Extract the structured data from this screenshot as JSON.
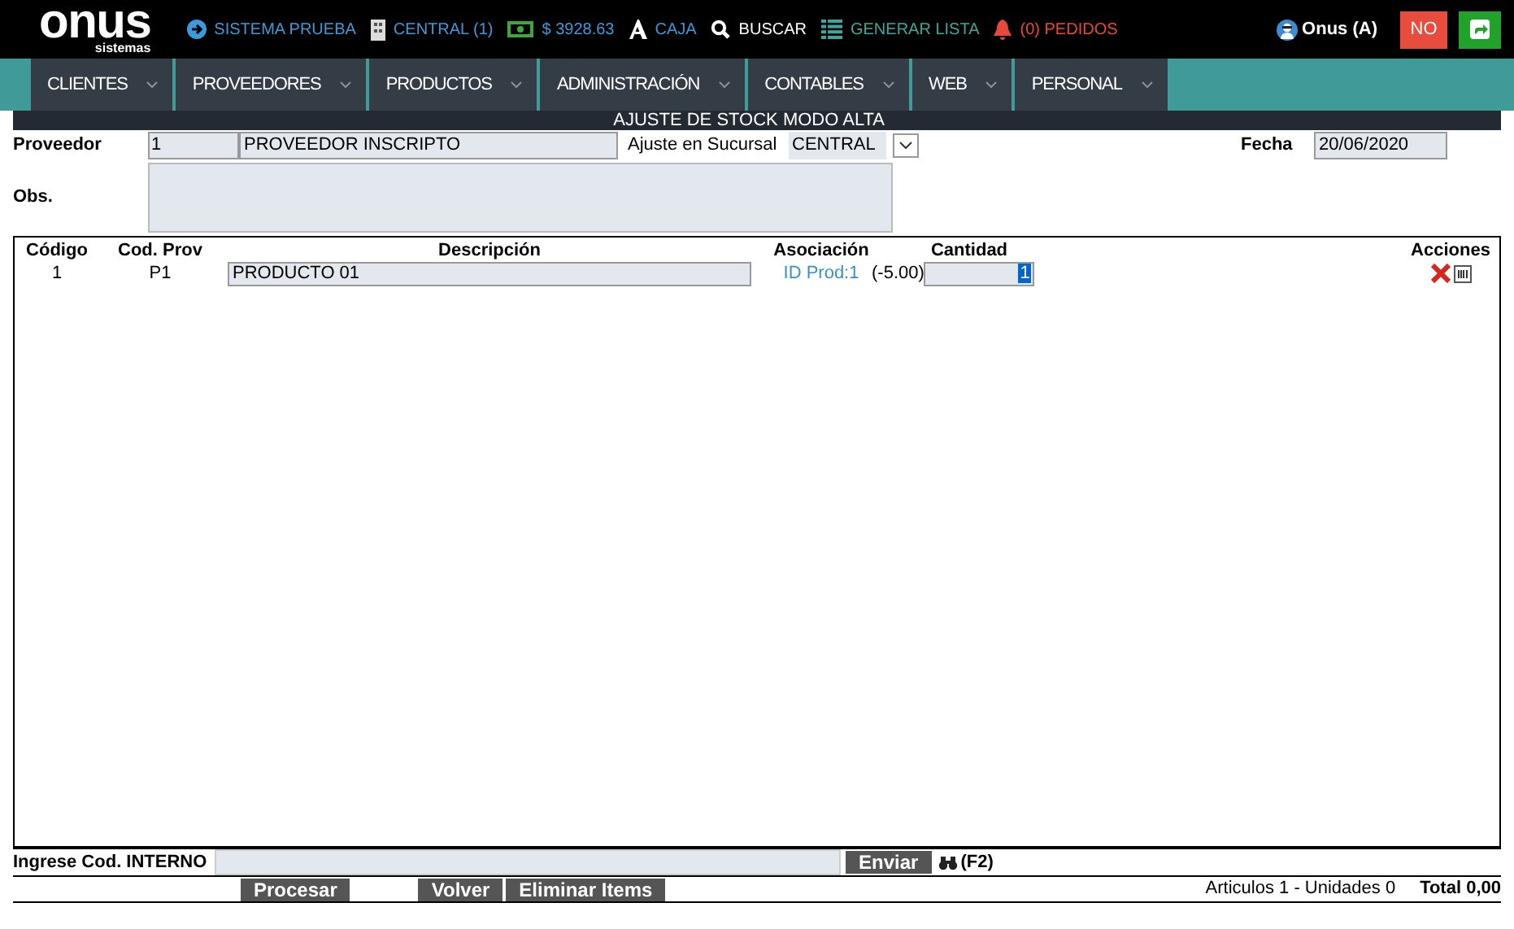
{
  "header": {
    "logo": "onus",
    "logo_sub": "sistemas",
    "items": [
      {
        "label": "SISTEMA PRUEBA",
        "color": "#3b9ad9"
      },
      {
        "label": "CENTRAL (1)",
        "color": "#3b9ad9"
      },
      {
        "label": "$ 3928.63",
        "color": "#3b9ad9"
      },
      {
        "label": "CAJA",
        "color": "#3b9ad9"
      },
      {
        "label": "BUSCAR",
        "color": "#ffffff"
      },
      {
        "label": "GENERAR LISTA",
        "color": "#3aa89c"
      },
      {
        "label": "(0) PEDIDOS",
        "color": "#e8473b"
      }
    ],
    "user": "Onus (A)",
    "no_button": "NO"
  },
  "nav": [
    "CLIENTES",
    "PROVEEDORES",
    "PRODUCTOS",
    "ADMINISTRACIÓN",
    "CONTABLES",
    "WEB",
    "PERSONAL"
  ],
  "title": "AJUSTE DE STOCK MODO ALTA",
  "form": {
    "proveedor_label": "Proveedor",
    "proveedor_code": "1",
    "proveedor_name": "PROVEEDOR INSCRIPTO",
    "sucursal_label": "Ajuste en Sucursal",
    "sucursal": "CENTRAL",
    "fecha_label": "Fecha",
    "fecha": "20/06/2020",
    "obs_label": "Obs."
  },
  "table": {
    "columns": [
      "Código",
      "Cod. Prov",
      "Descripción",
      "Asociación",
      "Cantidad",
      "Acciones"
    ],
    "rows": [
      {
        "codigo": "1",
        "cod_prov": "P1",
        "descripcion": "PRODUCTO 01",
        "asociacion": "ID Prod:1",
        "stock": "(-5.00)",
        "cantidad": "1"
      }
    ]
  },
  "footer": {
    "ingrese_label": "Ingrese Cod. INTERNO",
    "enviar": "Enviar",
    "shortcut": "(F2)",
    "buttons": [
      "Procesar",
      "Volver",
      "Eliminar Items"
    ],
    "summary": "Articulos 1 - Unidades 0",
    "total": "Total 0,00"
  }
}
